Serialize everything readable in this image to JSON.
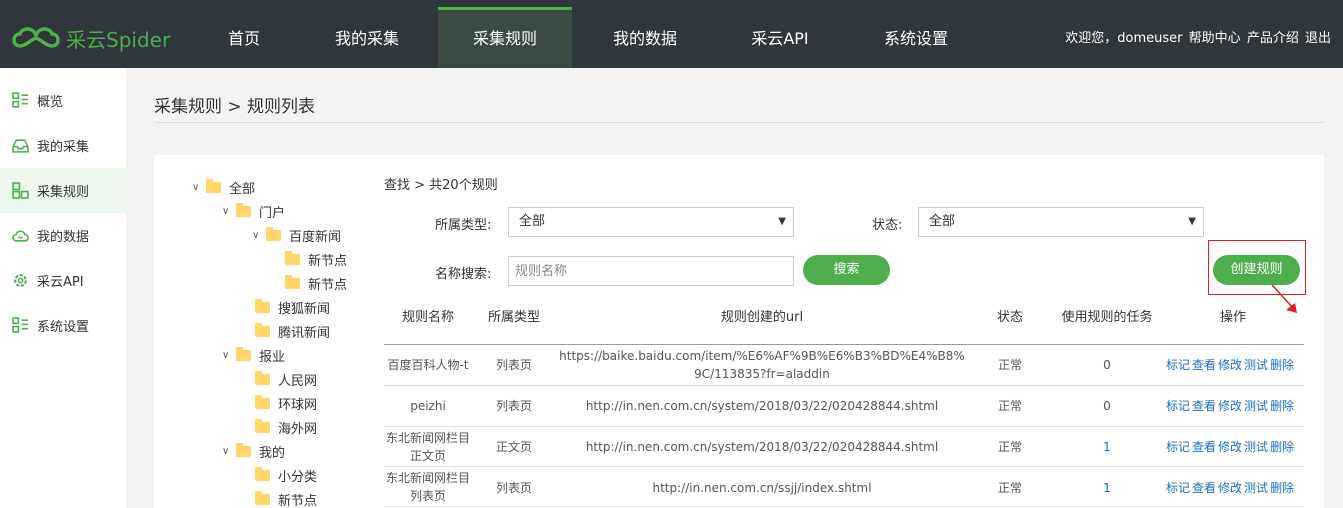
{
  "header": {
    "logo_text": "采云Spider",
    "nav": [
      "首页",
      "我的采集",
      "采集规则",
      "我的数据",
      "采云API",
      "系统设置"
    ],
    "active_nav": "采集规则",
    "welcome": "欢迎您，domeuser",
    "links": [
      "帮助中心",
      "产品介绍",
      "退出"
    ]
  },
  "sidebar": {
    "items": [
      {
        "label": "概览",
        "icon": "grid-list-icon"
      },
      {
        "label": "我的采集",
        "icon": "inbox-icon"
      },
      {
        "label": "采集规则",
        "icon": "rules-icon"
      },
      {
        "label": "我的数据",
        "icon": "cloud-data-icon"
      },
      {
        "label": "采云API",
        "icon": "gear-icon"
      },
      {
        "label": "系统设置",
        "icon": "settings-list-icon"
      }
    ],
    "active": "采集规则"
  },
  "breadcrumb": "采集规则 > 规则列表",
  "tree": [
    {
      "label": "全部",
      "expanded": true
    },
    {
      "label": "门户",
      "expanded": true
    },
    {
      "label": "百度新闻",
      "expanded": true
    },
    {
      "label": "新节点"
    },
    {
      "label": "新节点"
    },
    {
      "label": "搜狐新闻"
    },
    {
      "label": "腾讯新闻"
    },
    {
      "label": "报业",
      "expanded": true
    },
    {
      "label": "人民网"
    },
    {
      "label": "环球网"
    },
    {
      "label": "海外网"
    },
    {
      "label": "我的",
      "expanded": true
    },
    {
      "label": "小分类"
    },
    {
      "label": "新节点"
    }
  ],
  "filter": {
    "summary": "查找 > 共20个规则",
    "type_label": "所属类型:",
    "type_value": "全部",
    "status_label": "状态:",
    "status_value": "全部",
    "name_label": "名称搜索:",
    "name_placeholder": "规则名称",
    "search_button": "搜索",
    "create_button": "创建规则"
  },
  "table": {
    "headers": [
      "规则名称",
      "所属类型",
      "规则创建的url",
      "状态",
      "使用规则的任务",
      "操作"
    ],
    "ops": [
      "标记",
      "查看",
      "修改",
      "测试",
      "删除"
    ],
    "rows": [
      {
        "name": "百度百科人物-t",
        "type": "列表页",
        "url": "https://baike.baidu.com/item/%E6%AF%9B%E6%B3%BD%E4%B8%9C/113835?fr=aladdin",
        "status": "正常",
        "tasks": "0"
      },
      {
        "name": "peizhi",
        "type": "列表页",
        "url": "http://in.nen.com.cn/system/2018/03/22/020428844.shtml",
        "status": "正常",
        "tasks": "0"
      },
      {
        "name": "东北新闻网栏目正文页",
        "type": "正文页",
        "url": "http://in.nen.com.cn/system/2018/03/22/020428844.shtml",
        "status": "正常",
        "tasks": "1"
      },
      {
        "name": "东北新闻网栏目列表页",
        "type": "列表页",
        "url": "http://in.nen.com.cn/ssjj/index.shtml",
        "status": "正常",
        "tasks": "1"
      }
    ]
  }
}
